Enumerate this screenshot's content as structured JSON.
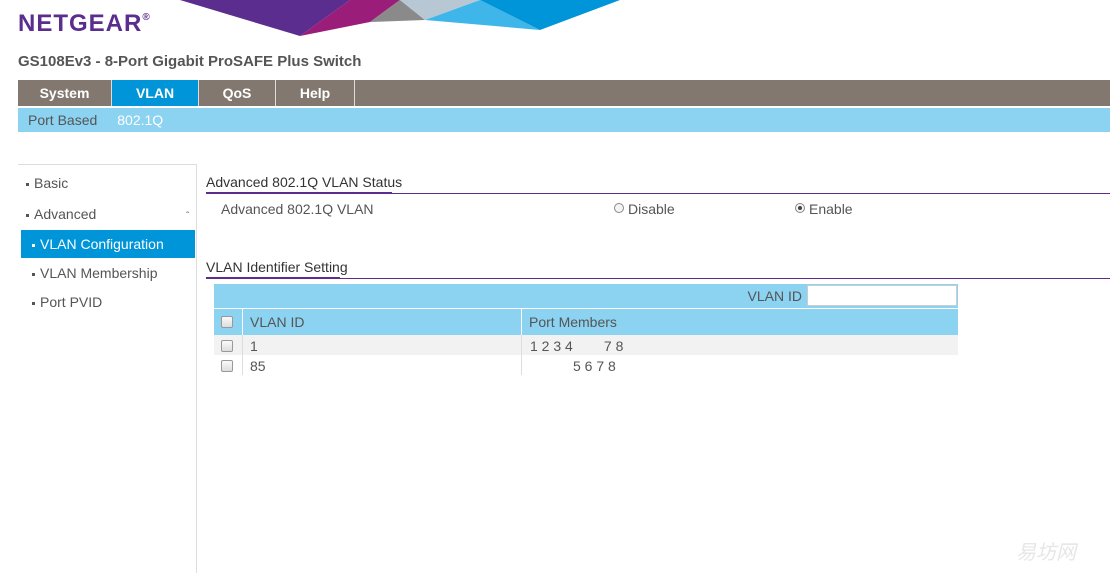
{
  "brand": {
    "logo": "NETGEAR",
    "reg": "®"
  },
  "product_title": "GS108Ev3 - 8-Port Gigabit ProSAFE Plus Switch",
  "main_nav": [
    "System",
    "VLAN",
    "QoS",
    "Help"
  ],
  "sub_nav": [
    "Port Based",
    "802.1Q"
  ],
  "sidebar": {
    "items": [
      "Basic",
      "Advanced",
      "VLAN Configuration",
      "VLAN Membership",
      "Port PVID"
    ],
    "caret": "ˆ"
  },
  "status_section": {
    "title": "Advanced 802.1Q VLAN Status",
    "row_label": "Advanced 802.1Q VLAN",
    "options": [
      "Disable",
      "Enable"
    ],
    "selected": "Enable"
  },
  "id_section": {
    "title": "VLAN Identifier Setting",
    "vlan_id_label": "VLAN ID",
    "vlan_id_value": "",
    "columns": [
      "VLAN ID",
      "Port Members"
    ],
    "rows": [
      {
        "vlan_id": "1",
        "ports": "1 2 3 4        7 8"
      },
      {
        "vlan_id": "85",
        "ports": "5 6 7 8"
      }
    ]
  },
  "watermark": "易坊网",
  "colors": {
    "purple": "#5b2d8e",
    "blue": "#0095d9",
    "light_blue": "#8cd3f1",
    "gray_nav": "#83786f"
  }
}
